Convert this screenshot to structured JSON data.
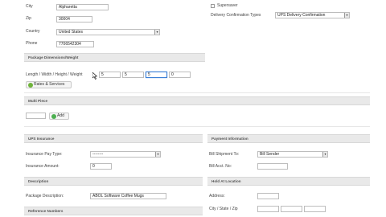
{
  "address": {
    "city_label": "City",
    "city_value": "Alpharetta",
    "zip_label": "Zip",
    "zip_value": "30004",
    "country_label": "Country",
    "country_value": "United States",
    "phone_label": "Phone",
    "phone_value": "7706542304"
  },
  "right_top": {
    "supersaver_label": "Supersaver",
    "delivery_label": "Delivery Confirmation Types",
    "delivery_value": "UPS Delivery Confirmation"
  },
  "package_dimensions": {
    "header": "Package Dimensions/Weight",
    "dims_label": "Length / Width / Height / Weight",
    "length": "5",
    "width": "5",
    "height": "5",
    "weight": "0",
    "rates_button": "Rates & Services"
  },
  "multi_piece": {
    "header": "Multi Piece",
    "add_button": "Add"
  },
  "ups_insurance": {
    "header": "UPS Insurance",
    "pay_type_label": "Insurance Pay Type:",
    "pay_type_value": "--------",
    "amount_label": "Insurance Amount:",
    "amount_value": "0"
  },
  "payment": {
    "header": "Payment Information",
    "bill_to_label": "Bill Shipment To:",
    "bill_to_value": "Bill Sender",
    "acct_label": "Bill Acct. No:"
  },
  "description": {
    "header": "Description",
    "package_label": "Package Description:",
    "package_value": "ABOL Software Coffee Mugs"
  },
  "hold_location": {
    "header": "Hold At Location",
    "address_label": "Address:",
    "city_state_zip_label": "City / State / Zip"
  },
  "reference": {
    "header": "Reference Numbers"
  },
  "colors": {
    "section_bar": "#e9e9e9",
    "focus_border": "#3b7fd6",
    "add_icon": "#4caf50",
    "rates_icon": "#6fb33b"
  }
}
